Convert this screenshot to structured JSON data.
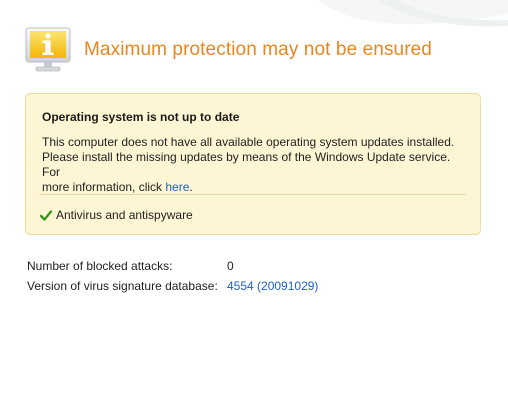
{
  "header": {
    "title": "Maximum protection may not be ensured",
    "icon": "info-warning-monitor-icon"
  },
  "notice": {
    "title": "Operating system is not up to date",
    "body_line1": "This computer does not have all available operating system updates installed.",
    "body_line2": "Please install the missing updates by means of the Windows Update service. For",
    "body_line3_prefix": "more information, click ",
    "link_text": "here",
    "body_line3_suffix": ".",
    "check_label": "Antivirus and antispyware"
  },
  "stats": {
    "blocked_attacks_label": "Number of blocked attacks:",
    "blocked_attacks_value": "0",
    "signature_label": "Version of virus signature database:",
    "signature_value": "4554 (20091029)"
  },
  "colors": {
    "title_orange": "#e9861e",
    "notice_bg": "#fdf5d4",
    "notice_border": "#efdc97",
    "link_blue": "#1f5fc4",
    "check_green": "#3a9a1f"
  }
}
